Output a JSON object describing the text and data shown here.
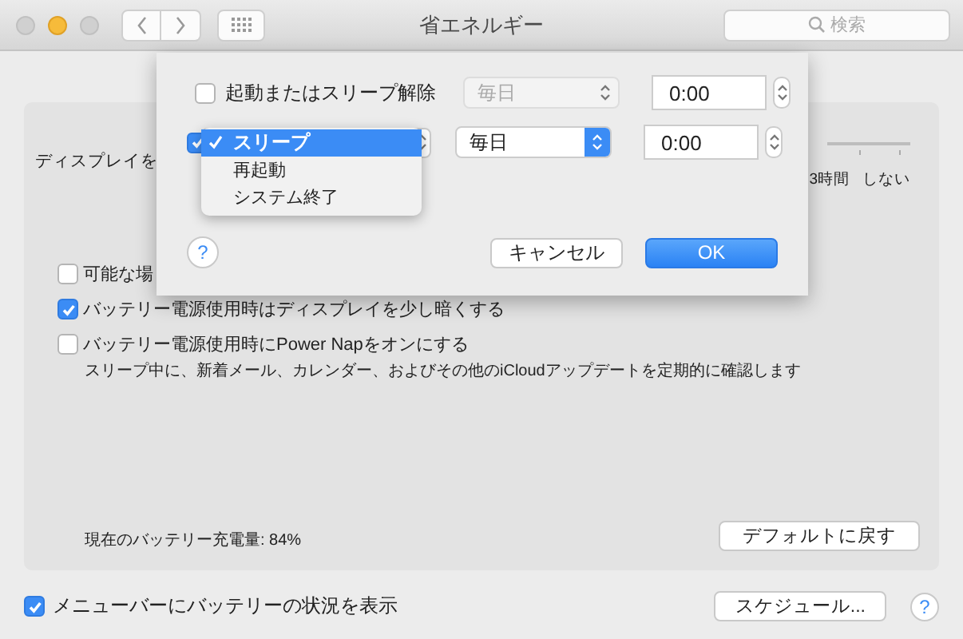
{
  "window": {
    "title": "省エネルギー",
    "search": {
      "placeholder": "検索"
    }
  },
  "panel": {
    "display_sleep_label": "ディスプレイを",
    "slider_labels": [
      "3時間",
      "しない"
    ],
    "options": [
      {
        "label": "可能な場",
        "checked": false
      },
      {
        "label": "バッテリー電源使用時はディスプレイを少し暗くする",
        "checked": true
      },
      {
        "label": "バッテリー電源使用時にPower Napをオンにする",
        "checked": false,
        "description": "スリープ中に、新着メール、カレンダー、およびその他のiCloudアップデートを定期的に確認します"
      }
    ],
    "battery_level_text": "現在のバッテリー充電量: 84%",
    "default_button": "デフォルトに戻す"
  },
  "footer": {
    "menu_bar_option": {
      "label": "メニューバーにバッテリーの状況を表示",
      "checked": true
    },
    "schedule_button": "スケジュール...",
    "help": "?"
  },
  "schedule_sheet": {
    "rows": [
      {
        "kind": "wake",
        "checked": false,
        "label": "起動またはスリープ解除",
        "repeat": "毎日",
        "repeat_disabled": true,
        "time": "0:00"
      },
      {
        "kind": "action",
        "checked": true,
        "repeat": "毎日",
        "repeat_disabled": false,
        "time": "0:00",
        "action_menu": [
          {
            "label": "スリープ",
            "selected": true
          },
          {
            "label": "再起動",
            "selected": false
          },
          {
            "label": "システム終了",
            "selected": false
          }
        ]
      }
    ],
    "help": "?",
    "buttons": [
      {
        "label": "キャンセル",
        "default": false
      },
      {
        "label": "OK",
        "default": true
      }
    ]
  }
}
